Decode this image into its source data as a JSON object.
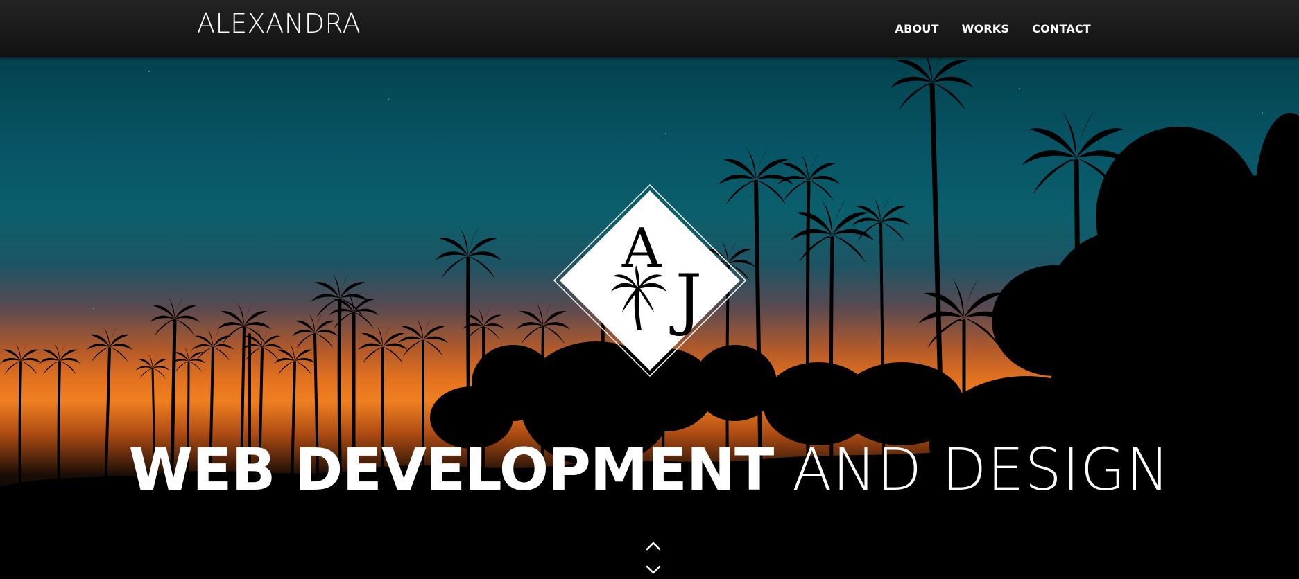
{
  "navbar": {
    "brand": "ALEXANDRA",
    "links": [
      "ABOUT",
      "WORKS",
      "CONTACT"
    ]
  },
  "hero": {
    "logo_letter_a": "A",
    "logo_letter_j": "J",
    "headline_bold": "WEB DEVELOPMENT",
    "headline_light": "AND DESIGN"
  },
  "icons": {
    "logo": "diamond-monogram-palm-icon",
    "scroll_up": "chevron-up-icon",
    "scroll_down": "chevron-down-icon"
  },
  "colors": {
    "navbar": "#1a1a1a",
    "sky_top": "#04424e",
    "sunset": "#ef7f20"
  }
}
